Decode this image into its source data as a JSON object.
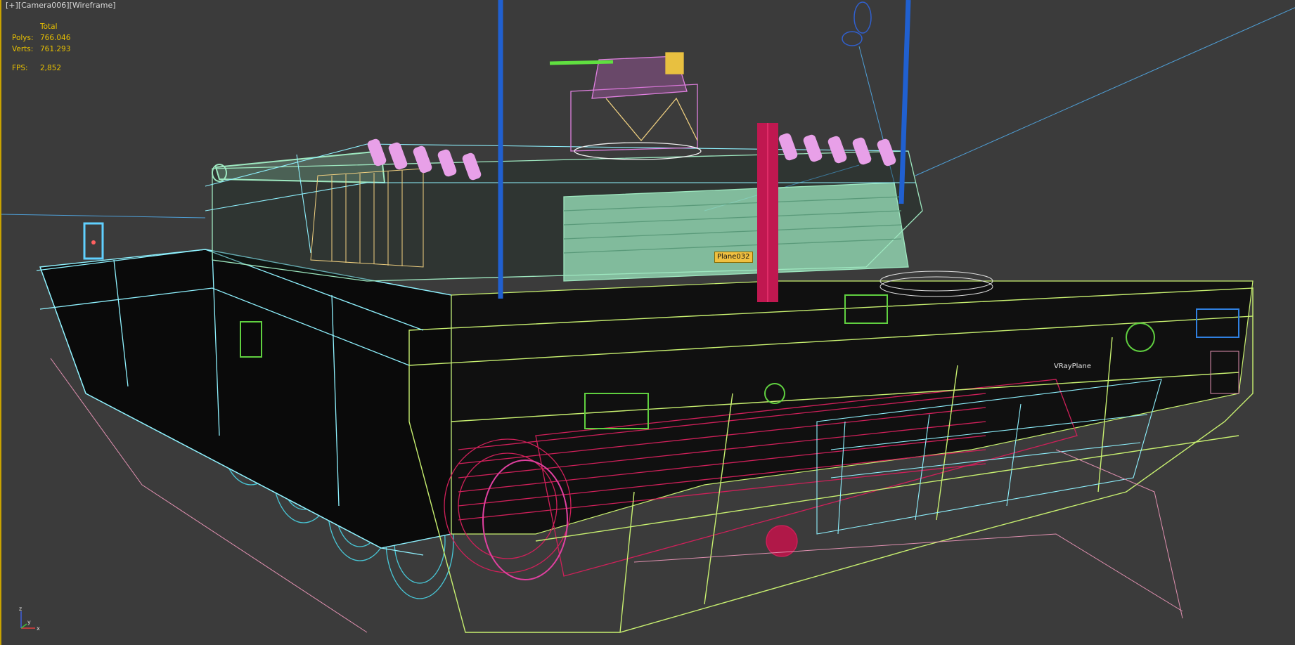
{
  "viewport": {
    "menu": "[+]",
    "camera": "[Camera006]",
    "mode": "[Wireframe]"
  },
  "stats": {
    "header": "Total",
    "polys_label": "Polys:",
    "polys_value": "766.046",
    "verts_label": "Verts:",
    "verts_value": "761.293",
    "fps_label": "FPS:",
    "fps_value": "2,852"
  },
  "objects": {
    "selected_label": "Plane032",
    "ground_label": "VRayPlane"
  },
  "axis": {
    "x": "x",
    "y": "y",
    "z": "z"
  },
  "colors": {
    "background": "#3b3b3b",
    "stat_text": "#e8c000",
    "hull_cyan": "#8ff2ff",
    "track_teal": "#48c8d8",
    "armor_green": "#c8f070",
    "turret_mint": "#9ee8c0",
    "crimson": "#d0205a",
    "magenta": "#e060e0",
    "blue_antenna": "#2060d0"
  }
}
